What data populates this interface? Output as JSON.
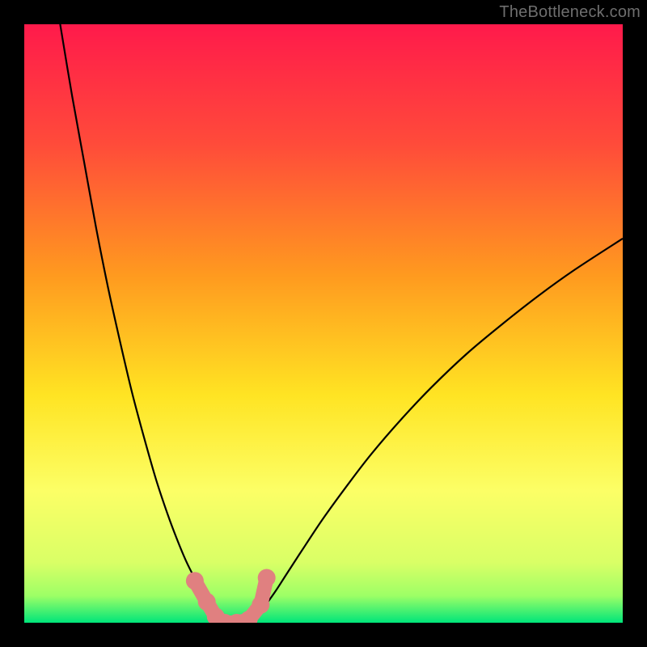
{
  "watermark": "TheBottleneck.com",
  "chart_data": {
    "type": "line",
    "title": "",
    "xlabel": "",
    "ylabel": "",
    "xlim": [
      0,
      100
    ],
    "ylim": [
      0,
      100
    ],
    "grid": false,
    "legend": false,
    "background_gradient": {
      "stops": [
        {
          "pos": 0.0,
          "color": "#ff1a4b"
        },
        {
          "pos": 0.2,
          "color": "#ff4b3a"
        },
        {
          "pos": 0.42,
          "color": "#ff9a1f"
        },
        {
          "pos": 0.62,
          "color": "#ffe423"
        },
        {
          "pos": 0.78,
          "color": "#fcff66"
        },
        {
          "pos": 0.9,
          "color": "#d9ff66"
        },
        {
          "pos": 0.955,
          "color": "#9dff66"
        },
        {
          "pos": 1.0,
          "color": "#00e57a"
        }
      ]
    },
    "series": [
      {
        "name": "left-curve",
        "color": "#000000",
        "x": [
          6,
          8,
          10,
          12,
          14,
          16,
          18,
          20,
          22,
          24,
          25.5,
          27,
          28.5,
          30,
          31,
          31.8,
          32.4,
          33
        ],
        "values": [
          100,
          88,
          77,
          66,
          56,
          47,
          38.5,
          31,
          24,
          18,
          14,
          10.4,
          7.4,
          4.8,
          3.2,
          2.0,
          1.0,
          0.0
        ]
      },
      {
        "name": "right-curve",
        "color": "#000000",
        "x": [
          38,
          39,
          40,
          42,
          44,
          47,
          50,
          54,
          58,
          63,
          68,
          74,
          80,
          86,
          92,
          100
        ],
        "values": [
          0.0,
          1.2,
          2.5,
          5.3,
          8.4,
          13.0,
          17.5,
          23.0,
          28.2,
          34.0,
          39.3,
          45.0,
          50.0,
          54.7,
          59.0,
          64.2
        ]
      },
      {
        "name": "marker-cluster",
        "type": "scatter",
        "color": "#e08080",
        "x": [
          28.5,
          30.5,
          32.0,
          33.5,
          35.5,
          37.5,
          39.5,
          40.5
        ],
        "values": [
          7.0,
          3.5,
          1.0,
          0.0,
          0.0,
          0.5,
          3.0,
          7.5
        ]
      }
    ]
  }
}
